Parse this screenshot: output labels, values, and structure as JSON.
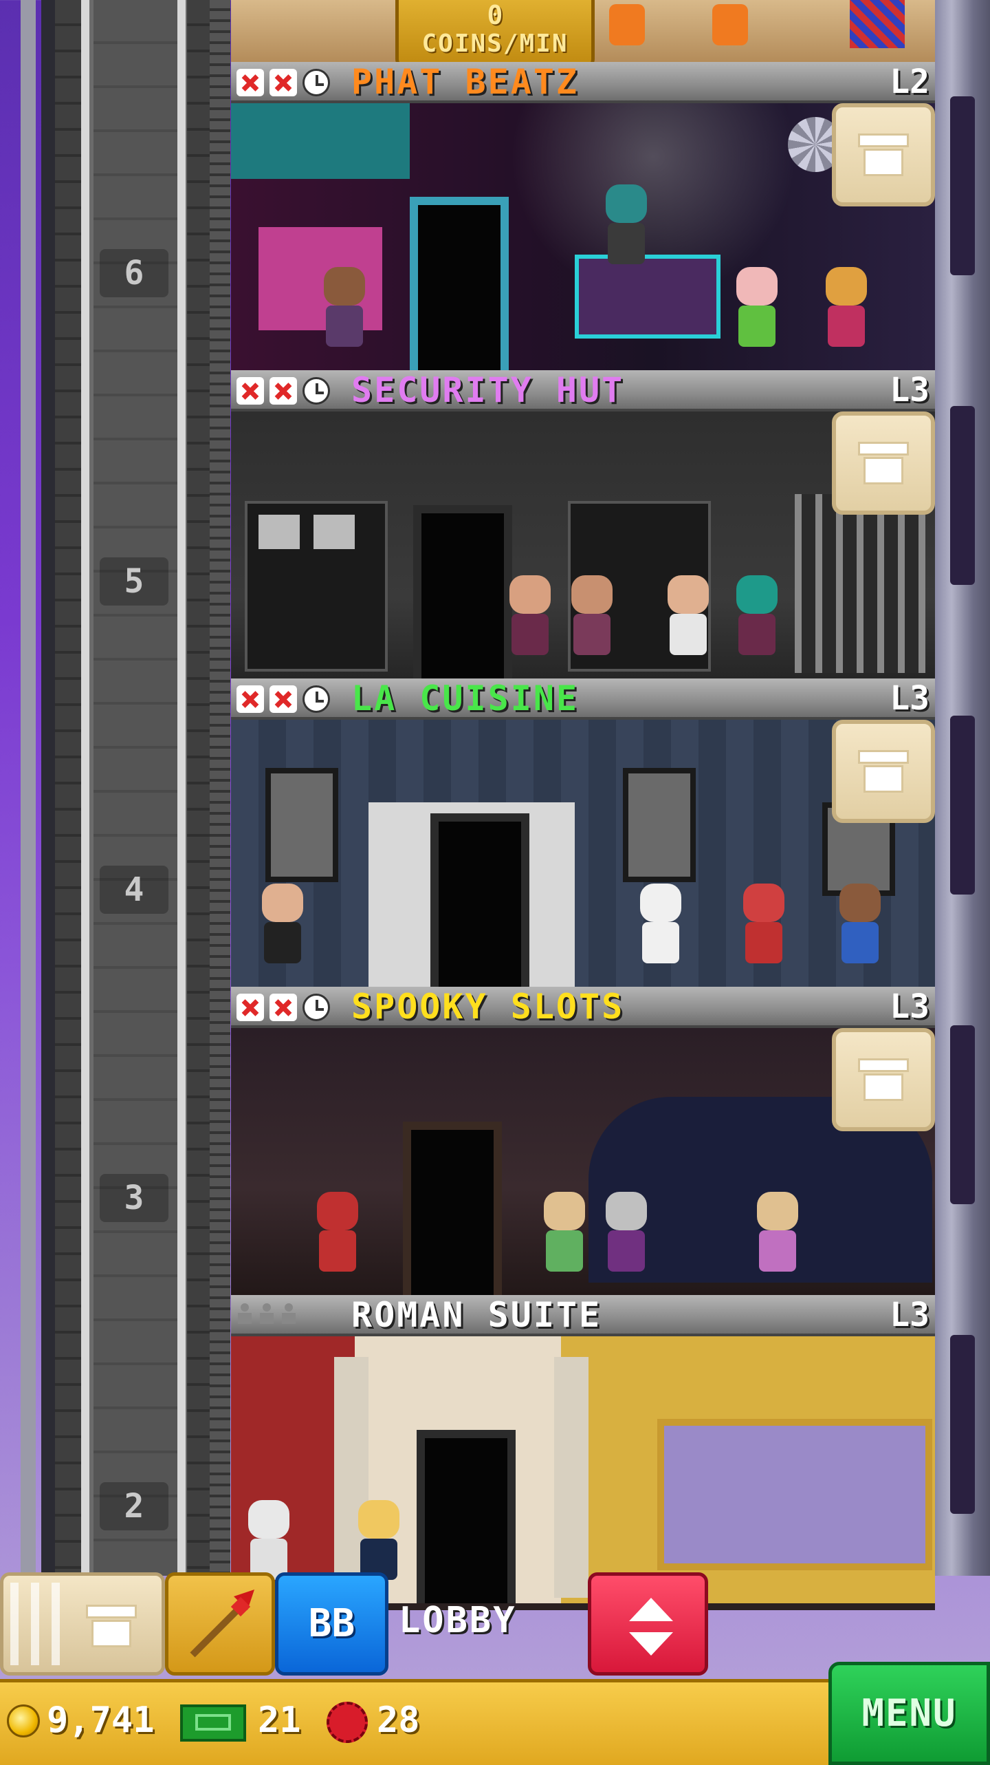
{
  "header": {
    "coins_per_min_value": "0",
    "coins_per_min_label": "COINS/MIN"
  },
  "floors": [
    {
      "number": "6",
      "name": "PHAT BEATZ",
      "level": "L2",
      "name_color": "#ff8a1e",
      "status": "stocking",
      "room_theme": "nightclub"
    },
    {
      "number": "5",
      "name": "SECURITY HUT",
      "level": "L3",
      "name_color": "#e07cf0",
      "status": "stocking",
      "room_theme": "security"
    },
    {
      "number": "4",
      "name": "LA CUISINE",
      "level": "L3",
      "name_color": "#49e64a",
      "status": "stocking",
      "room_theme": "restaurant"
    },
    {
      "number": "3",
      "name": "SPOOKY SLOTS",
      "level": "L3",
      "name_color": "#ffdf1e",
      "status": "stocking",
      "room_theme": "casino"
    },
    {
      "number": "2",
      "name": "ROMAN SUITE",
      "level": "L3",
      "name_color": "#ffffff",
      "status": "residential",
      "room_theme": "roman"
    }
  ],
  "toolbar": {
    "bb_label": "BB",
    "lobby_label": "LOBBY"
  },
  "status_bar": {
    "coins": "9,741",
    "bux": "21",
    "gems": "28",
    "menu_label": "MENU"
  },
  "colors": {
    "sky": "#7a3ad0",
    "status_bar": "#f0b92c",
    "menu_button": "#1fb844",
    "bb_button": "#1e8cf0",
    "elevator_button": "#ee2a4a"
  },
  "icons": [
    "coin-icon",
    "bux-icon",
    "gem-icon",
    "box-icon",
    "rocket-icon",
    "elevator-arrows-icon",
    "x-icon",
    "clock-icon"
  ]
}
